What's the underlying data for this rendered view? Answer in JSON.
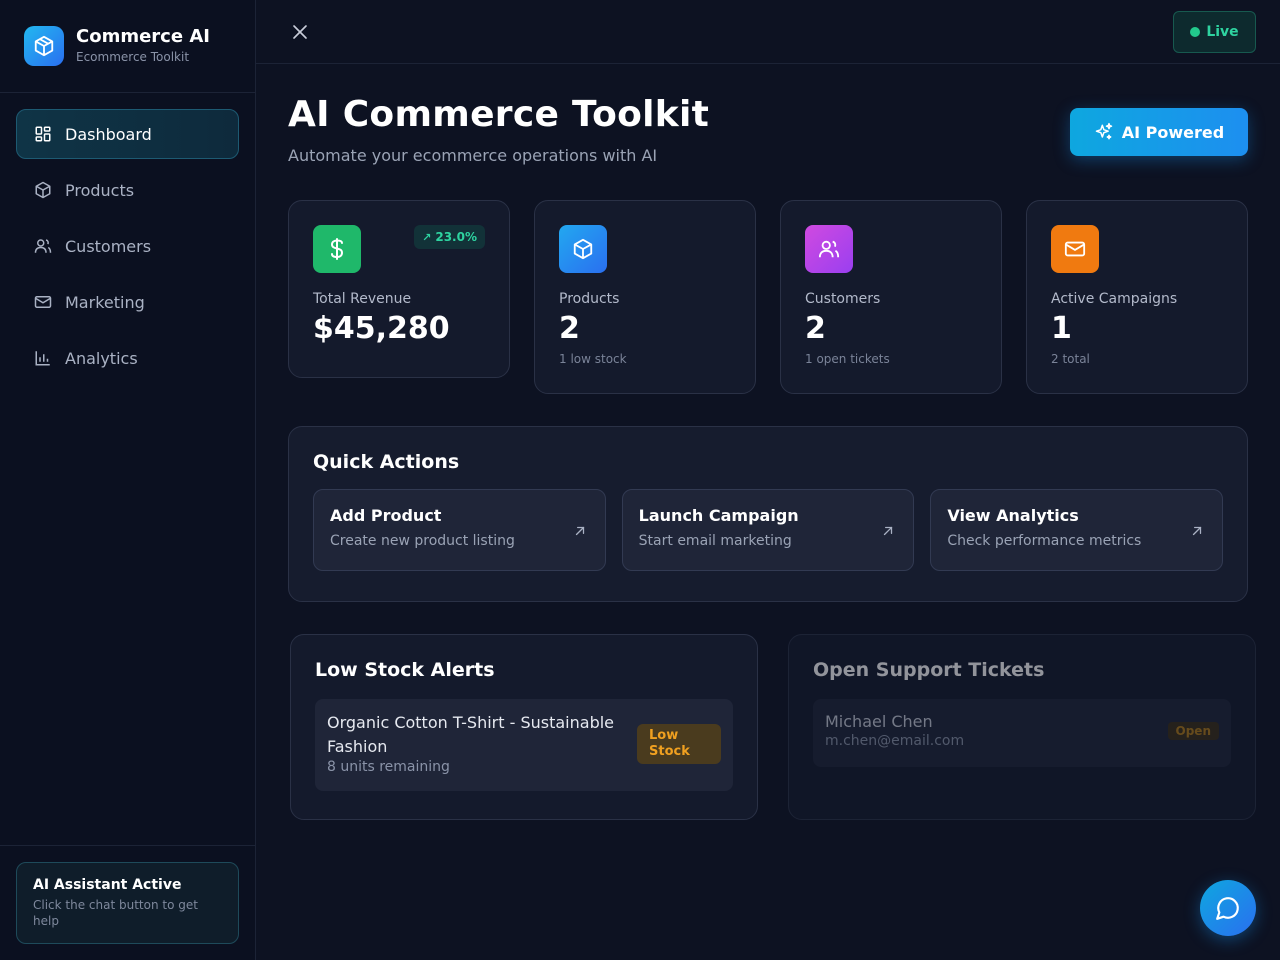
{
  "brand": {
    "title": "Commerce AI",
    "subtitle": "Ecommerce Toolkit"
  },
  "nav": [
    {
      "label": "Dashboard",
      "icon": "dashboard-icon",
      "active": true
    },
    {
      "label": "Products",
      "icon": "box-icon"
    },
    {
      "label": "Customers",
      "icon": "users-icon"
    },
    {
      "label": "Marketing",
      "icon": "mail-icon"
    },
    {
      "label": "Analytics",
      "icon": "bar-chart-icon"
    }
  ],
  "assistant": {
    "title": "AI Assistant Active",
    "text": "Click the chat button to get help"
  },
  "topbar": {
    "live_label": "Live"
  },
  "header": {
    "title": "AI Commerce Toolkit",
    "subtitle": "Automate your ecommerce operations with AI",
    "ai_button": "AI Powered"
  },
  "stats": [
    {
      "label": "Total Revenue",
      "value": "$45,280",
      "trend": "23.0%",
      "icon": "dollar-icon",
      "color": "#1fb86a"
    },
    {
      "label": "Products",
      "value": "2",
      "note": "1 low stock",
      "icon": "box-icon",
      "color": "#2a7ff0"
    },
    {
      "label": "Customers",
      "value": "2",
      "note": "1 open tickets",
      "icon": "users-icon",
      "color": "#c545e0"
    },
    {
      "label": "Active Campaigns",
      "value": "1",
      "note": "2 total",
      "icon": "mail-icon",
      "color": "#f07a10"
    }
  ],
  "quick_actions": {
    "title": "Quick Actions",
    "items": [
      {
        "title": "Add Product",
        "subtitle": "Create new product listing"
      },
      {
        "title": "Launch Campaign",
        "subtitle": "Start email marketing"
      },
      {
        "title": "View Analytics",
        "subtitle": "Check performance metrics"
      }
    ]
  },
  "low_stock": {
    "title": "Low Stock Alerts",
    "items": [
      {
        "name": "Organic Cotton T-Shirt - Sustainable Fashion",
        "units": "8 units remaining",
        "badge": "Low Stock"
      }
    ]
  },
  "tickets": {
    "title": "Open Support Tickets",
    "items": [
      {
        "name": "Michael Chen",
        "email": "m.chen@email.com",
        "badge": "Open"
      }
    ]
  }
}
